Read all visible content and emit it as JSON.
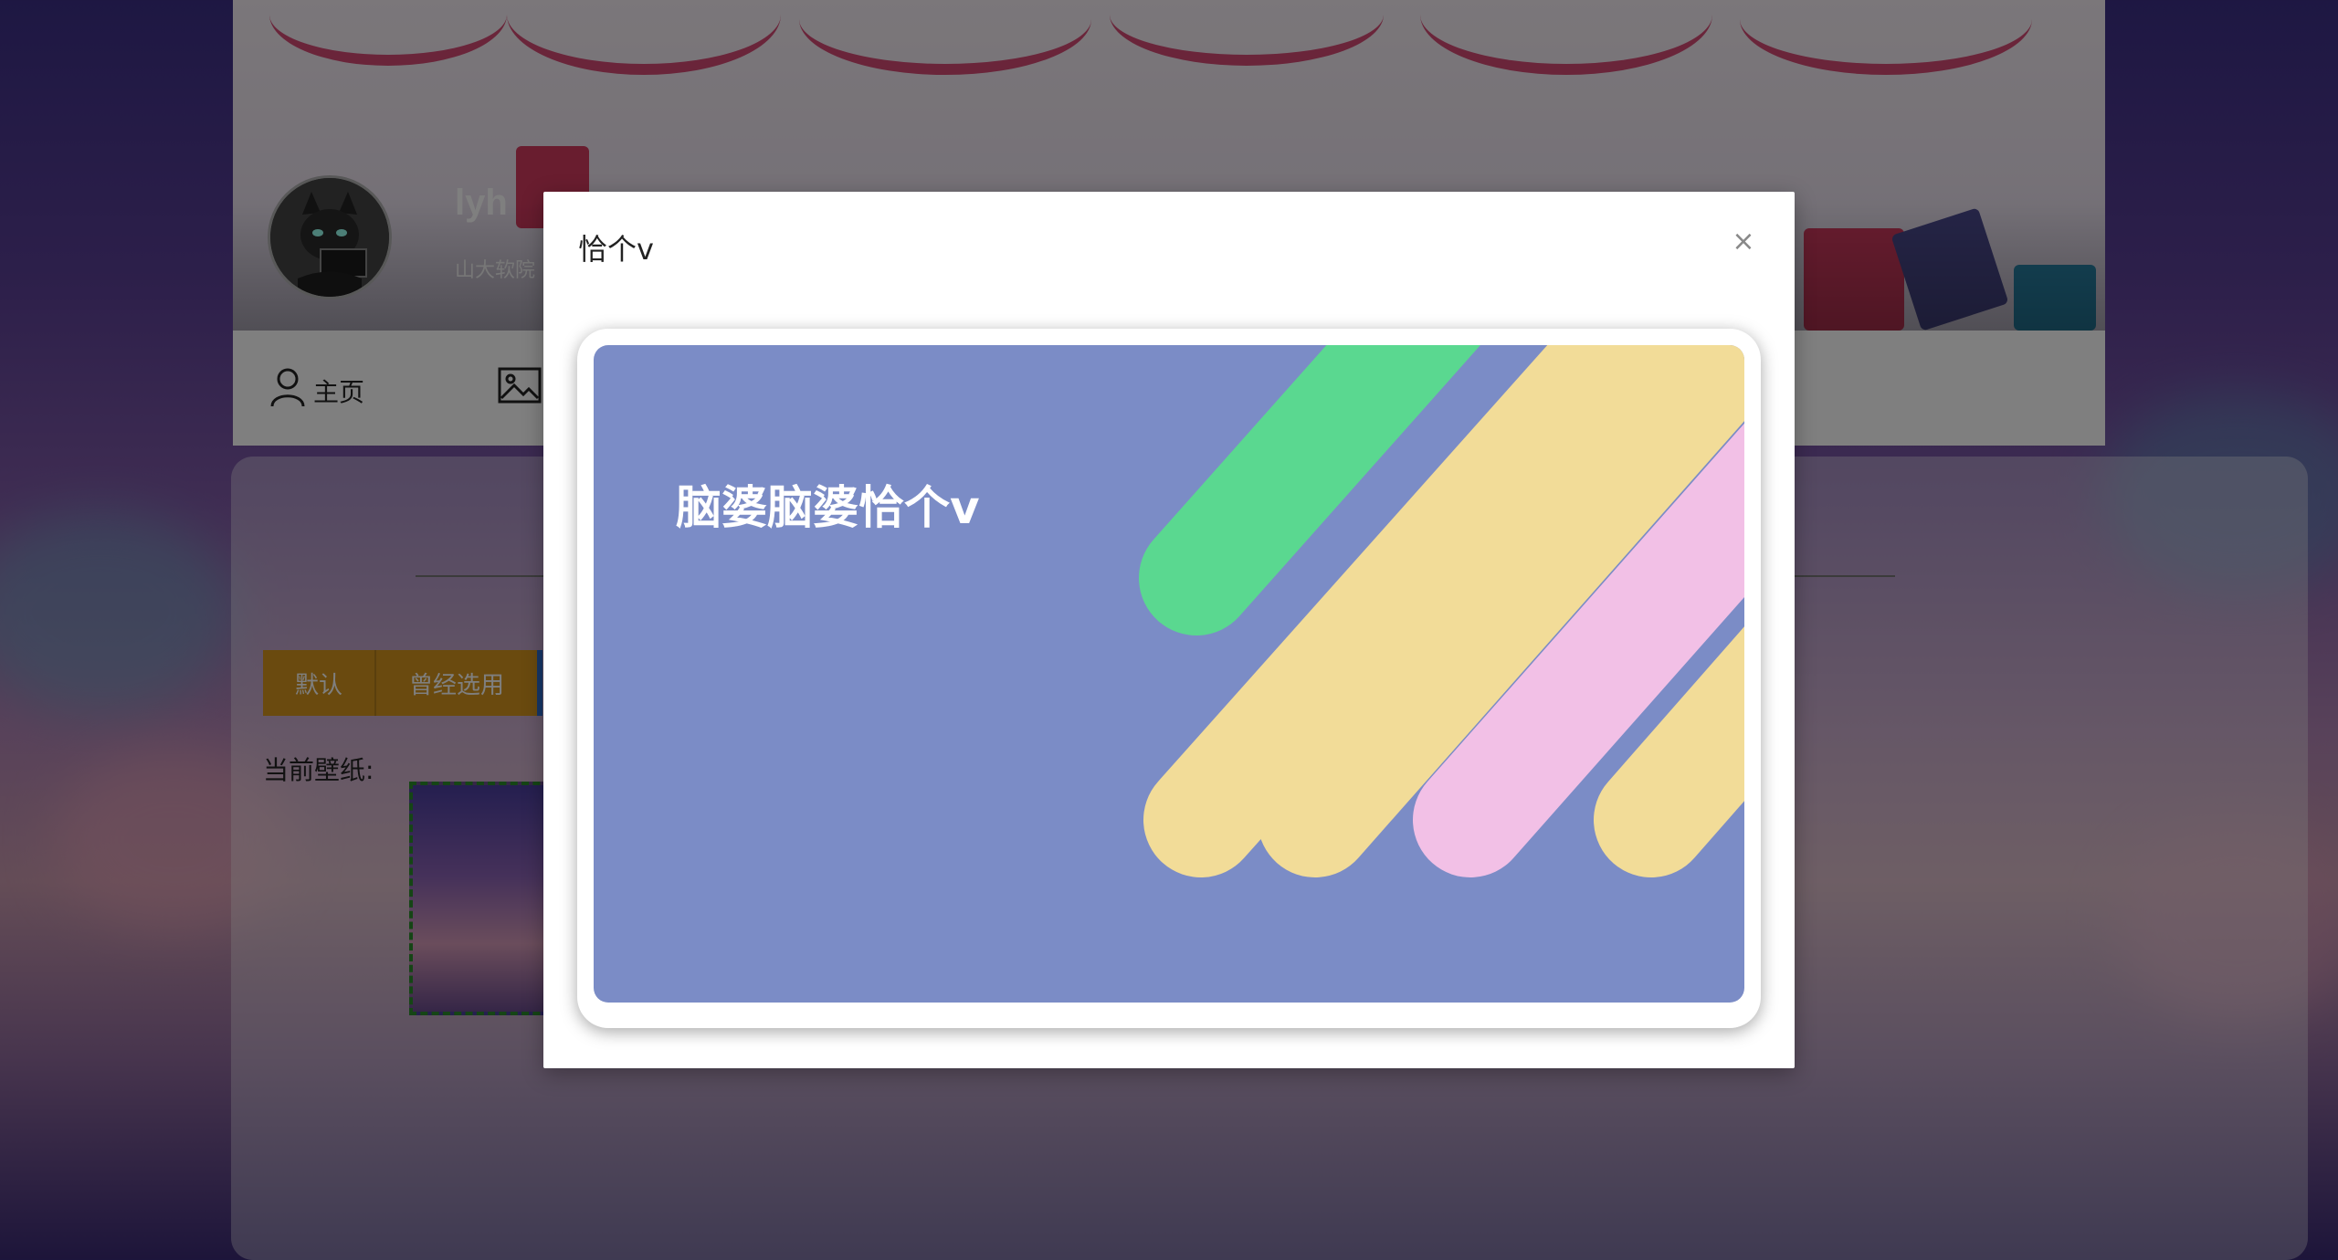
{
  "profile": {
    "username": "lyh",
    "subtitle": "山大软院"
  },
  "nav": {
    "items": [
      {
        "label": "主页",
        "icon": "user-icon"
      },
      {
        "label": "",
        "icon": "image-icon"
      }
    ]
  },
  "wallpaper": {
    "tabs": [
      {
        "label": "默认"
      },
      {
        "label": "曾经选用"
      }
    ],
    "current_label": "当前壁纸:"
  },
  "modal": {
    "title": "恰个v",
    "close_label": "×",
    "card_text": "脑婆脑婆恰个v"
  },
  "colors": {
    "tab_accent": "#d4951f",
    "card_background": "#7b8cc6",
    "stripe_green": "#5ad890",
    "stripe_yellow": "#f2dc98",
    "stripe_pink": "#f2c0e6"
  }
}
